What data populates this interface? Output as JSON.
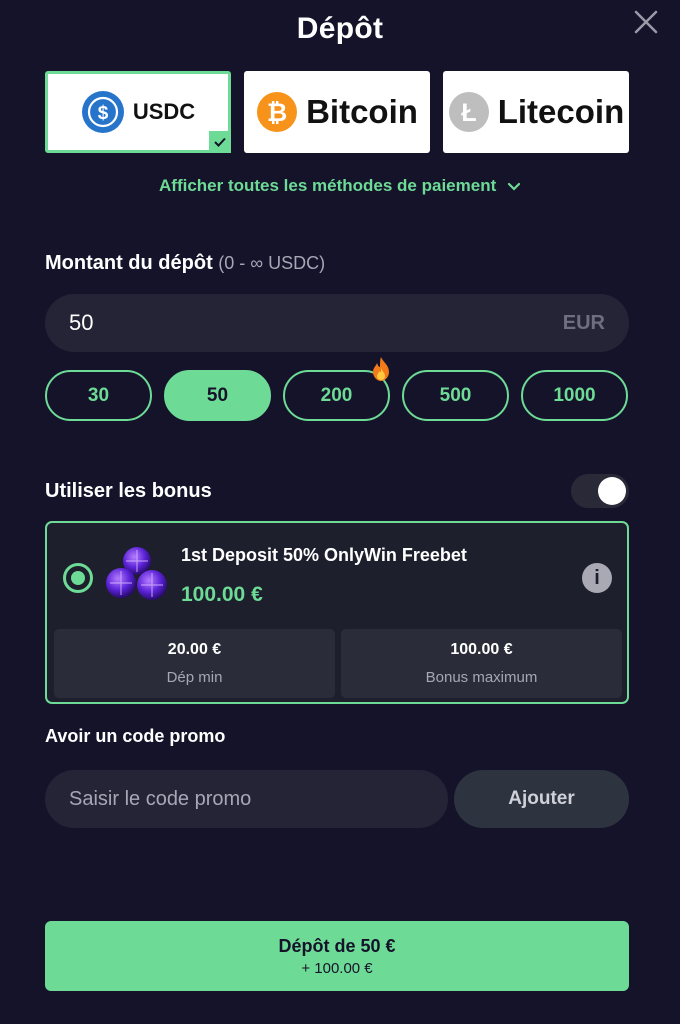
{
  "header": {
    "title": "Dépôt"
  },
  "payment_methods": [
    {
      "label": "USDC",
      "icon": "usdc-icon",
      "selected": true,
      "brand_color": "#2775ca"
    },
    {
      "label": "Bitcoin",
      "icon": "bitcoin-icon",
      "selected": false,
      "brand_color": "#f7931a"
    },
    {
      "label": "Litecoin",
      "icon": "litecoin-icon",
      "selected": false,
      "brand_color": "#bebebe"
    }
  ],
  "show_all_methods": "Afficher toutes les méthodes de paiement",
  "amount": {
    "label": "Montant du dépôt",
    "range": "(0 - ∞ USDC)",
    "value": "50",
    "currency": "EUR",
    "presets": [
      "30",
      "50",
      "200",
      "500",
      "1000"
    ],
    "active_preset": "50"
  },
  "bonus": {
    "label": "Utiliser les bonus",
    "enabled": true,
    "name": "1st Deposit 50% OnlyWin Freebet",
    "amount": "100.00 €",
    "min_deposit_value": "20.00 €",
    "min_deposit_label": "Dép min",
    "max_bonus_value": "100.00 €",
    "max_bonus_label": "Bonus maximum"
  },
  "promo": {
    "label": "Avoir un code promo",
    "placeholder": "Saisir le code promo",
    "button": "Ajouter"
  },
  "deposit_button": {
    "main": "Dépôt de 50 €",
    "sub": "+ 100.00 €"
  },
  "colors": {
    "accent": "#6ddb96",
    "background": "#15132a"
  }
}
